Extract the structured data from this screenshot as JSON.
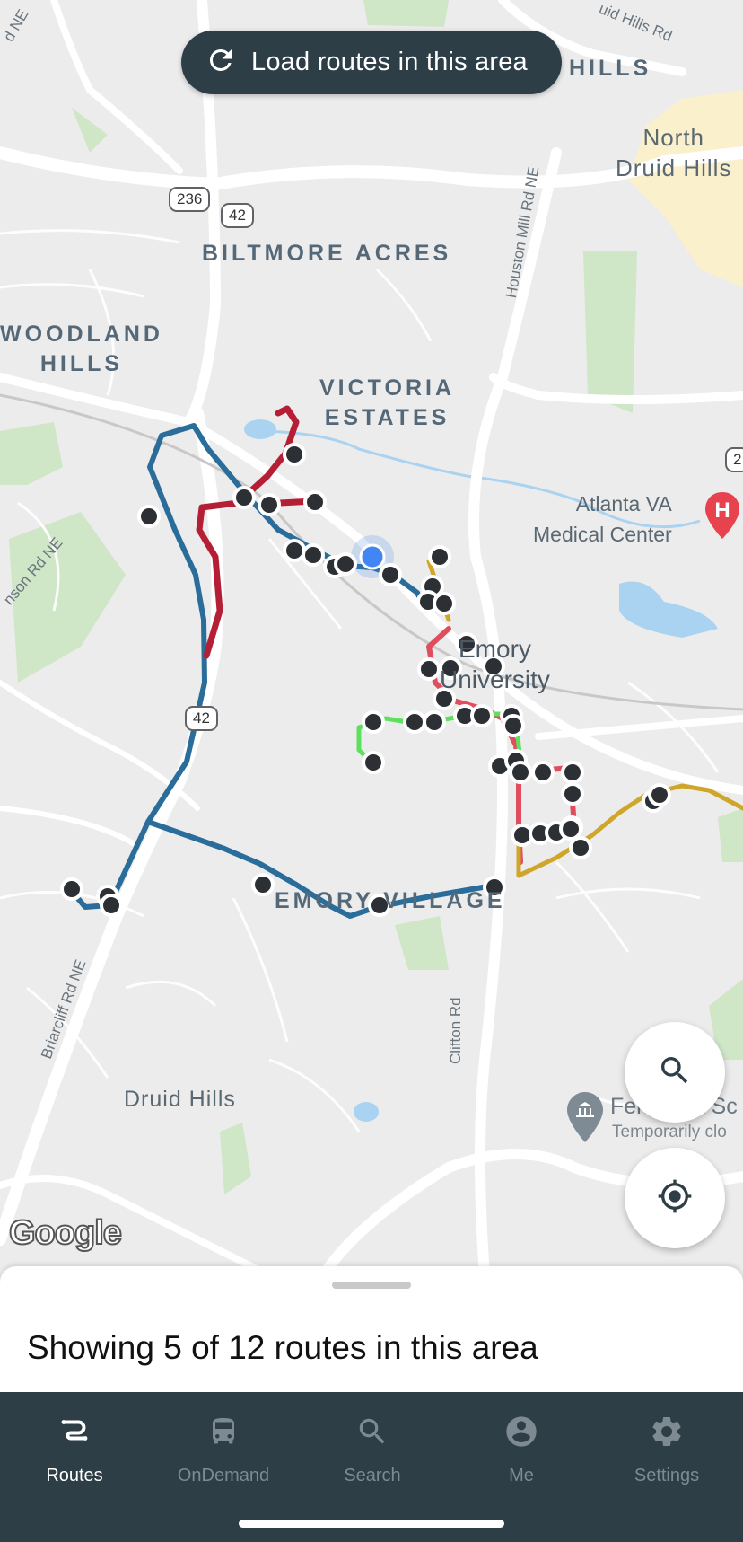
{
  "load_routes": {
    "label": "Load routes in this area",
    "icon": "refresh-icon"
  },
  "map": {
    "areas": {
      "hills": "HILLS",
      "north_druid_hills": "North\nDruid Hills",
      "biltmore_acres": "BILTMORE ACRES",
      "woodland_hills": "WOODLAND\nHILLS",
      "victoria_estates": "VICTORIA\nESTATES",
      "emory_university": "Emory\nUniversity",
      "emory_village": "EMORY VILLAGE",
      "druid_hills": "Druid Hills"
    },
    "roads": {
      "houston_mill": "Houston Mill Rd NE",
      "briarcliff": "Briarcliff Rd NE",
      "clifton": "Clifton Rd",
      "johnson": "nson Rd NE",
      "druid_hills_rd": "uid Hills Rd",
      "top_left": "d NE"
    },
    "shields": {
      "s236": "236",
      "s42a": "42",
      "s42b": "42",
      "s2": "2"
    },
    "pois": {
      "atlanta_va": "Atlanta VA\nMedical Center",
      "fernbank_name": "Fernbank Sc",
      "fernbank_status": "Temporarily clo"
    },
    "attribution": "Google",
    "route_colors": {
      "blue": "#2a6d9a",
      "red": "#b51f36",
      "pink": "#e04e5e",
      "green": "#5de05d",
      "gold": "#cfa629"
    }
  },
  "fabs": {
    "search_icon": "search-icon",
    "locate_icon": "my-location-icon"
  },
  "sheet": {
    "summary": "Showing 5 of 12 routes in this area"
  },
  "tabs": [
    {
      "label": "Routes",
      "icon": "routes-icon",
      "active": true
    },
    {
      "label": "OnDemand",
      "icon": "bus-icon",
      "active": false
    },
    {
      "label": "Search",
      "icon": "search-icon",
      "active": false
    },
    {
      "label": "Me",
      "icon": "account-icon",
      "active": false
    },
    {
      "label": "Settings",
      "icon": "gear-icon",
      "active": false
    }
  ]
}
